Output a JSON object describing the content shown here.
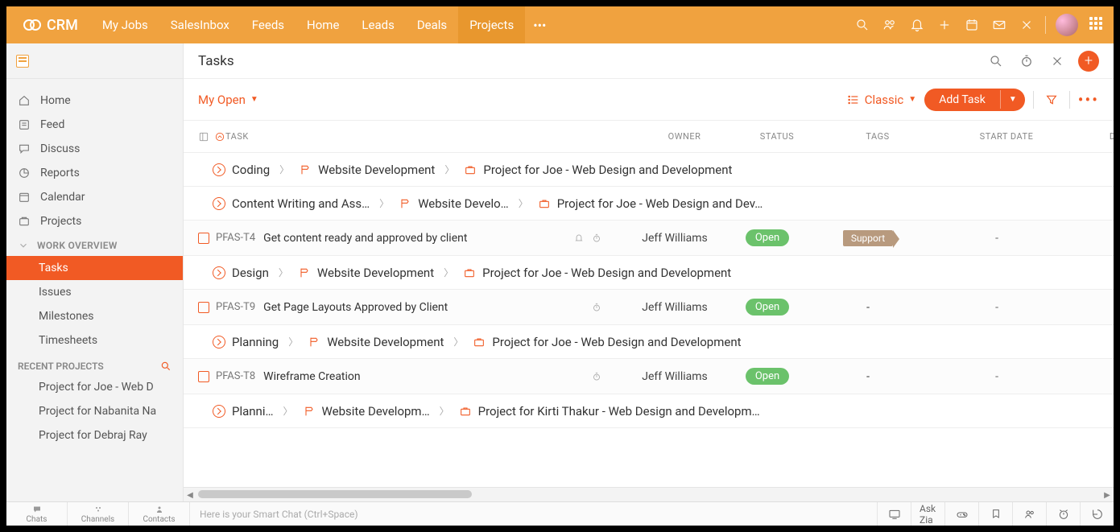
{
  "topnav": {
    "brand": "CRM",
    "links": [
      "My Jobs",
      "SalesInbox",
      "Feeds",
      "Home",
      "Leads",
      "Deals",
      "Projects"
    ],
    "active": "Projects"
  },
  "sidebar": {
    "items": [
      {
        "icon": "home",
        "label": "Home"
      },
      {
        "icon": "feed",
        "label": "Feed"
      },
      {
        "icon": "discuss",
        "label": "Discuss"
      },
      {
        "icon": "reports",
        "label": "Reports"
      },
      {
        "icon": "calendar",
        "label": "Calendar"
      },
      {
        "icon": "projects",
        "label": "Projects"
      }
    ],
    "section_label": "WORK OVERVIEW",
    "subs": [
      "Tasks",
      "Issues",
      "Milestones",
      "Timesheets"
    ],
    "active_sub": "Tasks",
    "recent_label": "RECENT PROJECTS",
    "recent": [
      "Project for Joe - Web D",
      "Project for Nabanita Na",
      "Project for Debraj Ray"
    ]
  },
  "page": {
    "title": "Tasks",
    "filter_label": "My Open",
    "view_label": "Classic",
    "add_button": "Add Task"
  },
  "columns": {
    "task": "TASK",
    "owner": "OWNER",
    "status": "STATUS",
    "tags": "TAGS",
    "start": "START DATE",
    "due": "DUE"
  },
  "groups": [
    {
      "crumb": [
        "Coding",
        "Website Development",
        "Project for Joe - Web Design and Development"
      ],
      "tasks": []
    },
    {
      "crumb": [
        "Content Writing and Ass…",
        "Website Develo…",
        "Project for Joe - Web Design and Dev…"
      ],
      "tasks": [
        {
          "id": "PFAS-T4",
          "name": "Get content ready and approved by client",
          "owner": "Jeff Williams",
          "status": "Open",
          "tag": "Support",
          "bell": true,
          "timer": true,
          "start": "-",
          "due": "-"
        }
      ]
    },
    {
      "crumb": [
        "Design",
        "Website Development",
        "Project for Joe - Web Design and Development"
      ],
      "tasks": [
        {
          "id": "PFAS-T9",
          "name": "Get Page Layouts Approved by Client",
          "owner": "Jeff Williams",
          "status": "Open",
          "tag": "",
          "bell": false,
          "timer": true,
          "start": "-",
          "due": "-"
        }
      ]
    },
    {
      "crumb": [
        "Planning",
        "Website Development",
        "Project for Joe - Web Design and Development"
      ],
      "tasks": [
        {
          "id": "PFAS-T8",
          "name": "Wireframe Creation",
          "owner": "Jeff Williams",
          "status": "Open",
          "tag": "",
          "bell": false,
          "timer": true,
          "start": "-",
          "due": "-"
        }
      ]
    },
    {
      "crumb": [
        "Planni…",
        "Website Developm…",
        "Project for Kirti Thakur - Web Design and Developm…"
      ],
      "tasks": []
    }
  ],
  "tags_values": {
    "dash": "-"
  },
  "bottom": {
    "tabs": [
      "Chats",
      "Channels",
      "Contacts"
    ],
    "smart": "Here is your Smart Chat (Ctrl+Space)",
    "askzia": "Ask Zia"
  }
}
